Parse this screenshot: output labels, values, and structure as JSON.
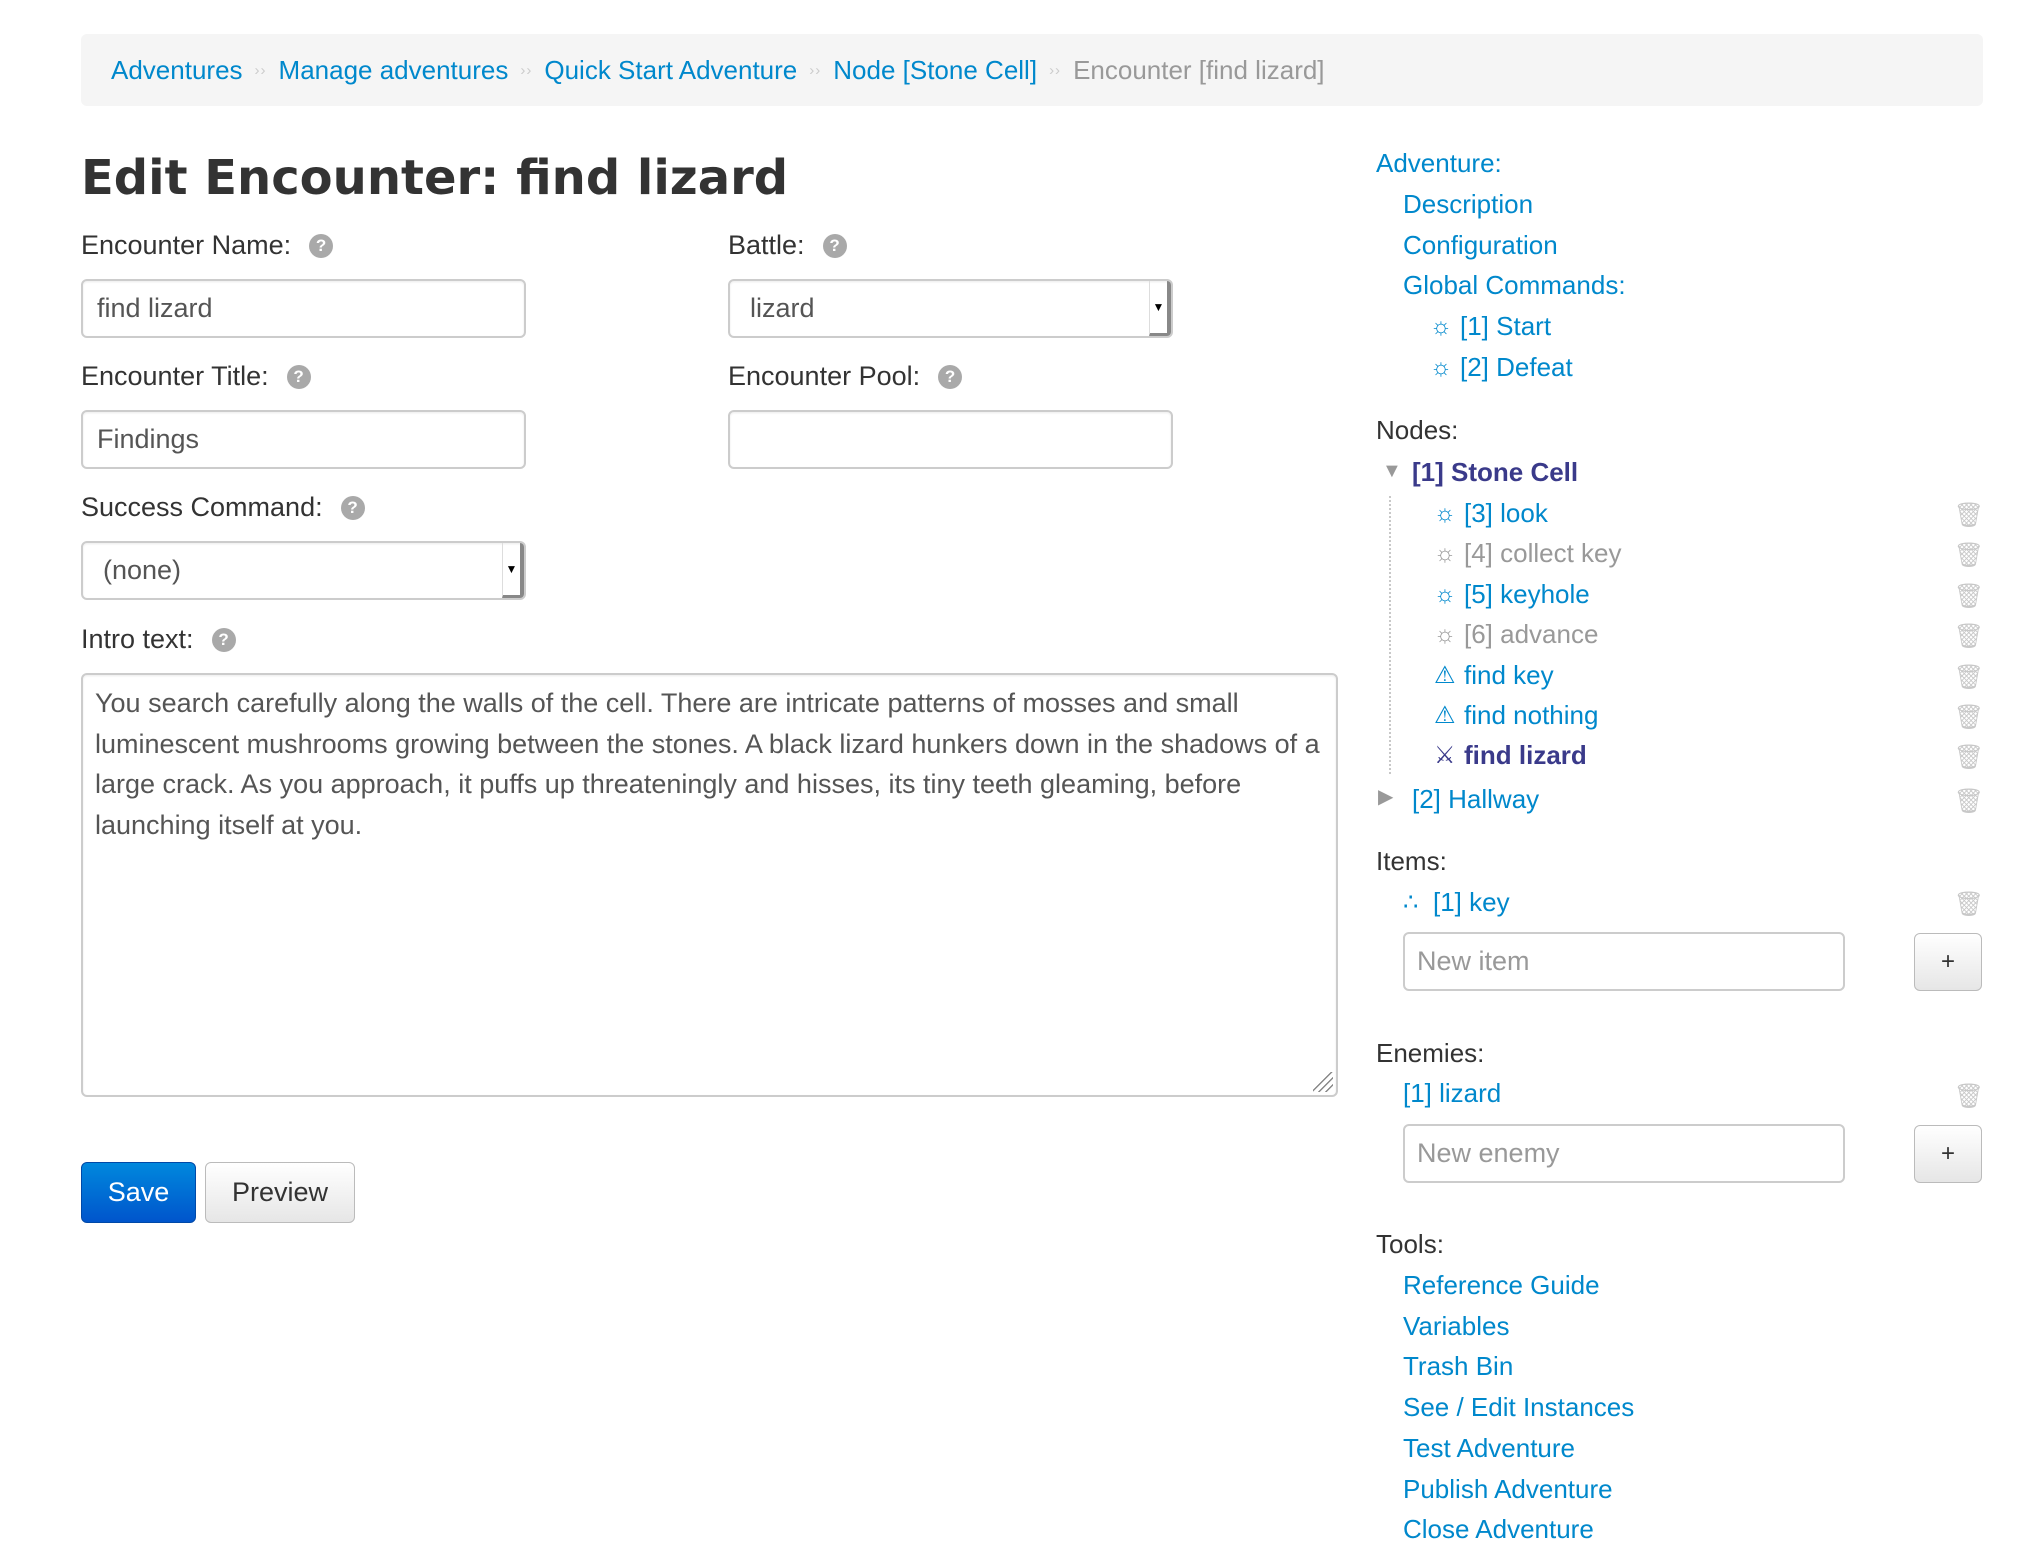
{
  "breadcrumb": {
    "items": [
      "Adventures",
      "Manage adventures",
      "Quick Start Adventure",
      "Node [Stone Cell]"
    ],
    "current": "Encounter [find lizard]",
    "separator": "››"
  },
  "page": {
    "title": "Edit Encounter: find lizard"
  },
  "form": {
    "encounter_name_label": "Encounter Name:",
    "encounter_name_value": "find lizard",
    "battle_label": "Battle:",
    "battle_value": "lizard",
    "encounter_title_label": "Encounter Title:",
    "encounter_title_value": "Findings",
    "encounter_pool_label": "Encounter Pool:",
    "encounter_pool_value": "",
    "success_command_label": "Success Command:",
    "success_command_value": "(none)",
    "intro_text_label": "Intro text:",
    "intro_text_value": "You search carefully along the walls of the cell. There are intricate patterns of mosses and small luminescent mushrooms growing between the stones. A black lizard hunkers down in the shadows of a large crack.  As you approach, it puffs up threateningly and hisses, its tiny teeth gleaming, before launching itself at you.",
    "help_glyph": "?",
    "save_label": "Save",
    "preview_label": "Preview"
  },
  "sidebar": {
    "adventure_label": "Adventure:",
    "description": "Description",
    "configuration": "Configuration",
    "global_commands_label": "Global Commands:",
    "global_commands": [
      "[1] Start",
      "[2] Defeat"
    ],
    "nodes_label": "Nodes:",
    "node1": "[1] Stone Cell",
    "node1_children": [
      "[3] look",
      "[4] collect key",
      "[5] keyhole",
      "[6] advance",
      "find key",
      "find nothing",
      "find lizard"
    ],
    "node2": "[2] Hallway",
    "items_label": "Items:",
    "items": [
      "[1] key"
    ],
    "new_item_placeholder": "New item",
    "enemies_label": "Enemies:",
    "enemies": [
      "[1] lizard"
    ],
    "new_enemy_placeholder": "New enemy",
    "add_label": "+",
    "tools_label": "Tools:",
    "tools": [
      "Reference Guide",
      "Variables",
      "Trash Bin",
      "See / Edit Instances",
      "Test Adventure",
      "Publish Adventure",
      "Close Adventure"
    ]
  },
  "icons": {
    "command": "gear-icon",
    "encounter": "warning-icon",
    "battle": "swords-icon",
    "item": "dots-icon",
    "delete": "trash-icon"
  },
  "colors": {
    "link": "#0088cc",
    "primary": "#0066cc",
    "active": "#3a3a8a",
    "muted": "#999999"
  }
}
